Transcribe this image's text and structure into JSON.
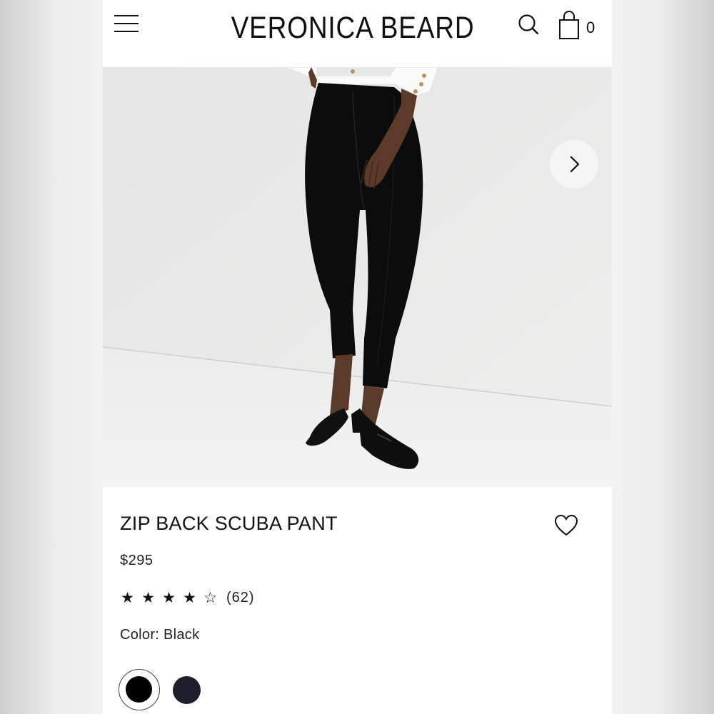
{
  "header": {
    "brand": "VERONICA BEARD",
    "cart_count": "0"
  },
  "product": {
    "title": "ZIP BACK SCUBA PANT",
    "price": "$295",
    "rating": {
      "value": 4,
      "max": 5,
      "review_count": "(62)"
    },
    "color_label": "Color: Black",
    "swatches": [
      {
        "name": "Black",
        "color": "#000000",
        "selected": true
      },
      {
        "name": "Navy",
        "color": "#1d1f2c",
        "selected": false
      }
    ]
  },
  "colors": {
    "text": "#111111",
    "background": "#ffffff",
    "image_wall": "#e9e9e9",
    "image_floor": "#efefef"
  }
}
